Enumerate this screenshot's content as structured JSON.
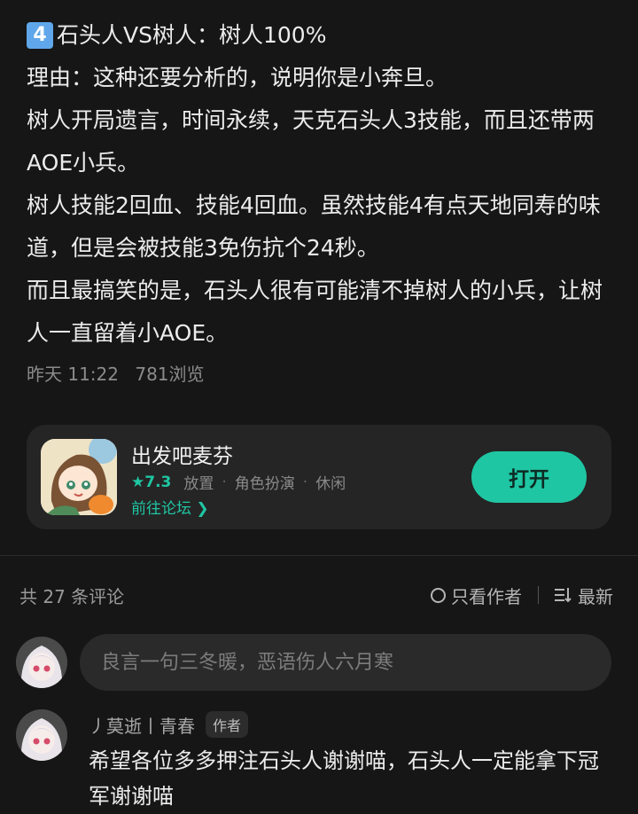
{
  "post": {
    "title_badge": "4",
    "title_text": "石头人VS树人：树人100%",
    "paragraphs": [
      "理由：这种还要分析的，说明你是小奔旦。",
      "树人开局遗言，时间永续，天克石头人3技能，而且还带两AOE小兵。",
      "树人技能2回血、技能4回血。虽然技能4有点天地同寿的味道，但是会被技能3免伤抗个24秒。",
      "而且最搞笑的是，石头人很有可能清不掉树人的小兵，让树人一直留着小AOE。"
    ],
    "time": "昨天 11:22",
    "views": "781浏览"
  },
  "game_card": {
    "name": "出发吧麦芬",
    "rating": "★7.3",
    "tags": [
      "放置",
      "角色扮演",
      "休闲"
    ],
    "tag_separator": "·",
    "forum_link": "前往论坛 ❯",
    "open_button": "打开",
    "accent_color": "#1fc6a3"
  },
  "comments": {
    "count_label": "共 27 条评论",
    "only_author": "只看作者",
    "sort_label": "最新",
    "input_placeholder": "良言一句三冬暖，恶语伤人六月寒",
    "items": [
      {
        "user": "丿莫逝丨青春",
        "tag": "作者",
        "text": "希望各位多多押注石头人谢谢喵，石头人一定能拿下冠军谢谢喵"
      }
    ]
  }
}
